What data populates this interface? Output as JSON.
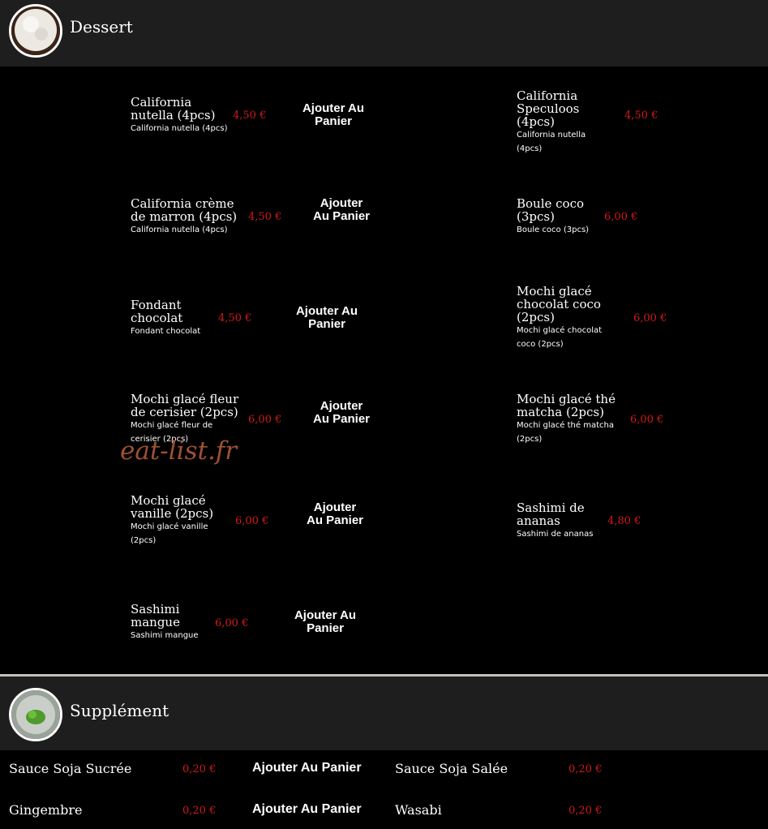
{
  "dessert": {
    "title": "Dessert",
    "items": [
      {
        "name": "California nutella (4pcs)",
        "desc": "California nutella (4pcs)",
        "price": "4,50 €",
        "add": "Ajouter Au Panier"
      },
      {
        "name": "California Speculoos (4pcs)",
        "desc": "California nutella (4pcs)",
        "price": "4,50 €"
      },
      {
        "name": "California crème de marron (4pcs)",
        "desc": "California nutella (4pcs)",
        "price": "4,50 €",
        "add": "Ajouter Au Panier"
      },
      {
        "name": "Boule coco (3pcs)",
        "desc": "Boule coco (3pcs)",
        "price": "6,00 €"
      },
      {
        "name": "Fondant chocolat",
        "desc": "Fondant chocolat",
        "price": "4,50 €",
        "add": "Ajouter Au Panier"
      },
      {
        "name": "Mochi glacé chocolat coco (2pcs)",
        "desc": "Mochi glacé chocolat coco (2pcs)",
        "price": "6,00 €"
      },
      {
        "name": "Mochi glacé fleur de cerisier (2pcs)",
        "desc": "Mochi glacé fleur de cerisier (2pcs)",
        "price": "6,00 €",
        "add": "Ajouter Au Panier"
      },
      {
        "name": "Mochi glacé thé matcha (2pcs)",
        "desc": "Mochi glacé thé matcha (2pcs)",
        "price": "6,00 €"
      },
      {
        "name": "Mochi glacé vanille (2pcs)",
        "desc": "Mochi glacé vanille (2pcs)",
        "price": "6,00 €",
        "add": "Ajouter Au Panier"
      },
      {
        "name": "Sashimi de ananas",
        "desc": "Sashimi de ananas",
        "price": "4,80 €"
      },
      {
        "name": "Sashimi mangue",
        "desc": "Sashimi mangue",
        "price": "6,00 €",
        "add": "Ajouter Au Panier"
      }
    ]
  },
  "watermark": "eat-list.fr",
  "supplement": {
    "title": "Supplément",
    "items": [
      {
        "name": "Sauce Soja Sucrée",
        "price": "0,20 €",
        "add": "Ajouter Au Panier"
      },
      {
        "name": "Sauce Soja Salée",
        "price": "0,20 €"
      },
      {
        "name": "Gingembre",
        "price": "0,20 €",
        "add": "Ajouter Au Panier"
      },
      {
        "name": "Wasabi",
        "price": "0,20 €"
      }
    ]
  },
  "colors": {
    "price": "#d21919",
    "header_bg": "#1e1e1e",
    "watermark": "#b05a38"
  }
}
